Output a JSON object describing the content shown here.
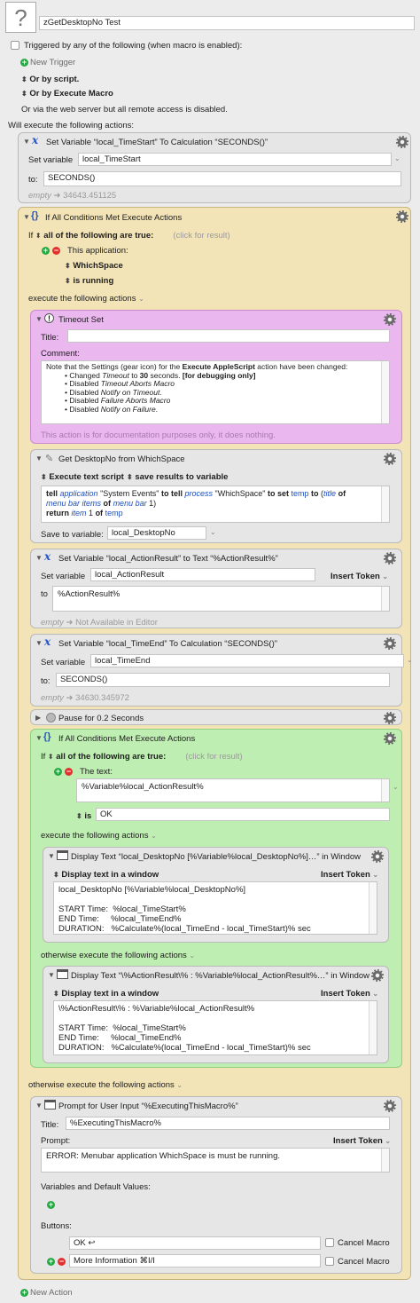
{
  "header": {
    "macro_name": "zGetDesktopNo Test",
    "triggered_label": "Triggered by any of the following (when macro is enabled):",
    "new_trigger": "New Trigger",
    "or_by_script": "Or by script.",
    "or_by_execute_macro": "Or by Execute Macro",
    "web_server_note": "Or via the web server but all remote access is disabled.",
    "will_execute": "Will execute the following actions:"
  },
  "a1": {
    "title": "Set Variable “local_TimeStart” To Calculation “SECONDS()”",
    "set_variable_label": "Set variable",
    "var_value": "local_TimeStart",
    "to_label": "to:",
    "to_value": "SECONDS()",
    "result_empty": "empty",
    "result_value": "34643.451125"
  },
  "if1": {
    "title": "If All Conditions Met Execute Actions",
    "if_label": "If",
    "all_label": "all of the following are true:",
    "click_result": "(click for result)",
    "cond_label": "This application:",
    "app_name": "WhichSpace",
    "app_state": "is running",
    "execute_label": "execute the following actions",
    "otherwise_label": "otherwise execute the following actions"
  },
  "timeout": {
    "title": "Timeout Set",
    "title_label": "Title:",
    "comment_label": "Comment:",
    "comment_line1_pre": "Note that the Settings (gear icon) for the ",
    "comment_line1_bold": "Execute AppleScript",
    "comment_line1_post": " action have been changed:",
    "bullets": [
      "• Changed ",
      "Timeout",
      " to ",
      "30",
      " seconds. ",
      "[for debugging only]"
    ],
    "b2": "• Disabled ",
    "b2i": "Timeout Aborts Macro",
    "b3": "• Disabled ",
    "b3i": "Notify on Timeout",
    "b3e": ".",
    "b4": "• Disabled ",
    "b4i": "Failure Aborts Macro",
    "b5": "• Disabled ",
    "b5i": "Notify on Failure",
    "b5e": ".",
    "doc_note": "This action is for documentation purposes only, it does nothing."
  },
  "script": {
    "title": "Get DesktopNo from WhichSpace",
    "exec_label": "Execute text script",
    "save_label": "save results to variable",
    "save_to_label": "Save to variable:",
    "save_var": "local_DesktopNo"
  },
  "a3": {
    "title": "Set Variable “local_ActionResult” to Text “%ActionResult%”",
    "set_variable_label": "Set variable",
    "var_value": "local_ActionResult",
    "insert_token": "Insert Token",
    "to_label": "to",
    "to_value": "%ActionResult%",
    "result_empty": "empty",
    "result_value": "Not Available in Editor"
  },
  "a4": {
    "title": "Set Variable “local_TimeEnd” To Calculation “SECONDS()”",
    "set_variable_label": "Set variable",
    "var_value": "local_TimeEnd",
    "to_label": "to:",
    "to_value": "SECONDS()",
    "result_empty": "empty",
    "result_value": "34630.345972"
  },
  "pause": {
    "title": "Pause for 0.2 Seconds"
  },
  "if2": {
    "title": "If All Conditions Met Execute Actions",
    "if_label": "If",
    "all_label": "all of the following are true:",
    "click_result": "(click for result)",
    "cond_label": "The text:",
    "text_value": "%Variable%local_ActionResult%",
    "is_label": "is",
    "is_value": "OK",
    "execute_label": "execute the following actions",
    "otherwise_label": "otherwise execute the following actions"
  },
  "disp1": {
    "title": "Display Text “local_DesktopNo [%Variable%local_DesktopNo%]…” in Window",
    "mode": "Display text in a window",
    "insert_token": "Insert Token",
    "text": "local_DesktopNo [%Variable%local_DesktopNo%]\n\nSTART Time:  %local_TimeStart%\nEND Time:     %local_TimeEnd%\nDURATION:   %Calculate%(local_TimeEnd - local_TimeStart)% sec"
  },
  "disp2": {
    "title": "Display Text “\\%ActionResult\\% : %Variable%local_ActionResult%…” in Window",
    "mode": "Display text in a window",
    "insert_token": "Insert Token",
    "text": "\\%ActionResult\\% : %Variable%local_ActionResult%\n\nSTART Time:  %local_TimeStart%\nEND Time:     %local_TimeEnd%\nDURATION:   %Calculate%(local_TimeEnd - local_TimeStart)% sec"
  },
  "prompt": {
    "title": "Prompt for User Input “%ExecutingThisMacro%”",
    "title_label": "Title:",
    "title_value": "%ExecutingThisMacro%",
    "prompt_label": "Prompt:",
    "insert_token": "Insert Token",
    "prompt_value": "ERROR: Menubar application WhichSpace is must be running.",
    "vars_label": "Variables and Default Values:",
    "buttons_label": "Buttons:",
    "btn1": "OK ↩",
    "btn2": "More Information  ⌘I/I",
    "cancel_macro": "Cancel Macro"
  },
  "footer": {
    "new_action": "New Action"
  }
}
